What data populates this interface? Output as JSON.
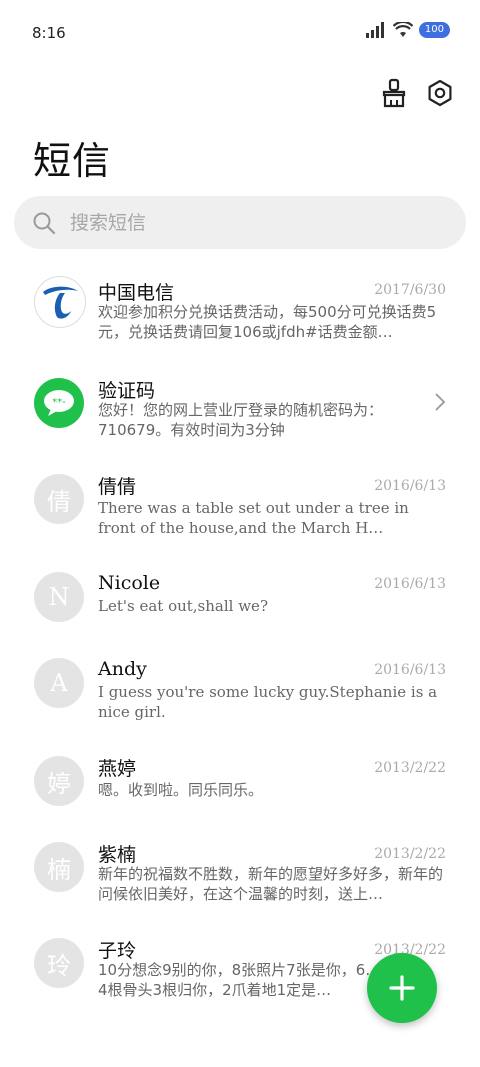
{
  "status": {
    "time": "8:16",
    "battery": "100"
  },
  "header": {
    "title": "短信"
  },
  "search": {
    "placeholder": "搜索短信"
  },
  "threads": [
    {
      "name": "中国电信",
      "date": "2017/6/30",
      "preview": "欢迎参加积分兑换话费活动，每500分可兑换话费5元，兑换话费请回复106或jfdh#话费金额…"
    },
    {
      "name": "验证码",
      "date": "",
      "preview": "您好！您的网上营业厅登录的随机密码为：710679。有效时间为3分钟"
    },
    {
      "name": "倩倩",
      "initial": "倩",
      "date": "2016/6/13",
      "preview": "There was a table set out under a tree in front of the house,and the March H…"
    },
    {
      "name": "Nicole",
      "initial": "N",
      "date": "2016/6/13",
      "preview": "Let's eat out,shall we?"
    },
    {
      "name": "Andy",
      "initial": "A",
      "date": "2016/6/13",
      "preview": "I guess you're some lucky guy.Stephanie is a nice girl."
    },
    {
      "name": "燕婷",
      "initial": "婷",
      "date": "2013/2/22",
      "preview": "嗯。收到啦。同乐同乐。"
    },
    {
      "name": "紫楠",
      "initial": "楠",
      "date": "2013/2/22",
      "preview": "新年的祝福数不胜数，新年的愿望好多好多，新年的问候依旧美好，在这个温馨的时刻，送上…"
    },
    {
      "name": "子玲",
      "initial": "玲",
      "date": "2013/2/22",
      "preview": "10分想念9别的你，8张照片7张是你，6…只像你，4根骨头3根归你，2爪着地1定是…"
    }
  ],
  "colors": {
    "accent_green": "#1fc14b",
    "telecom_blue": "#1a5fb4"
  }
}
